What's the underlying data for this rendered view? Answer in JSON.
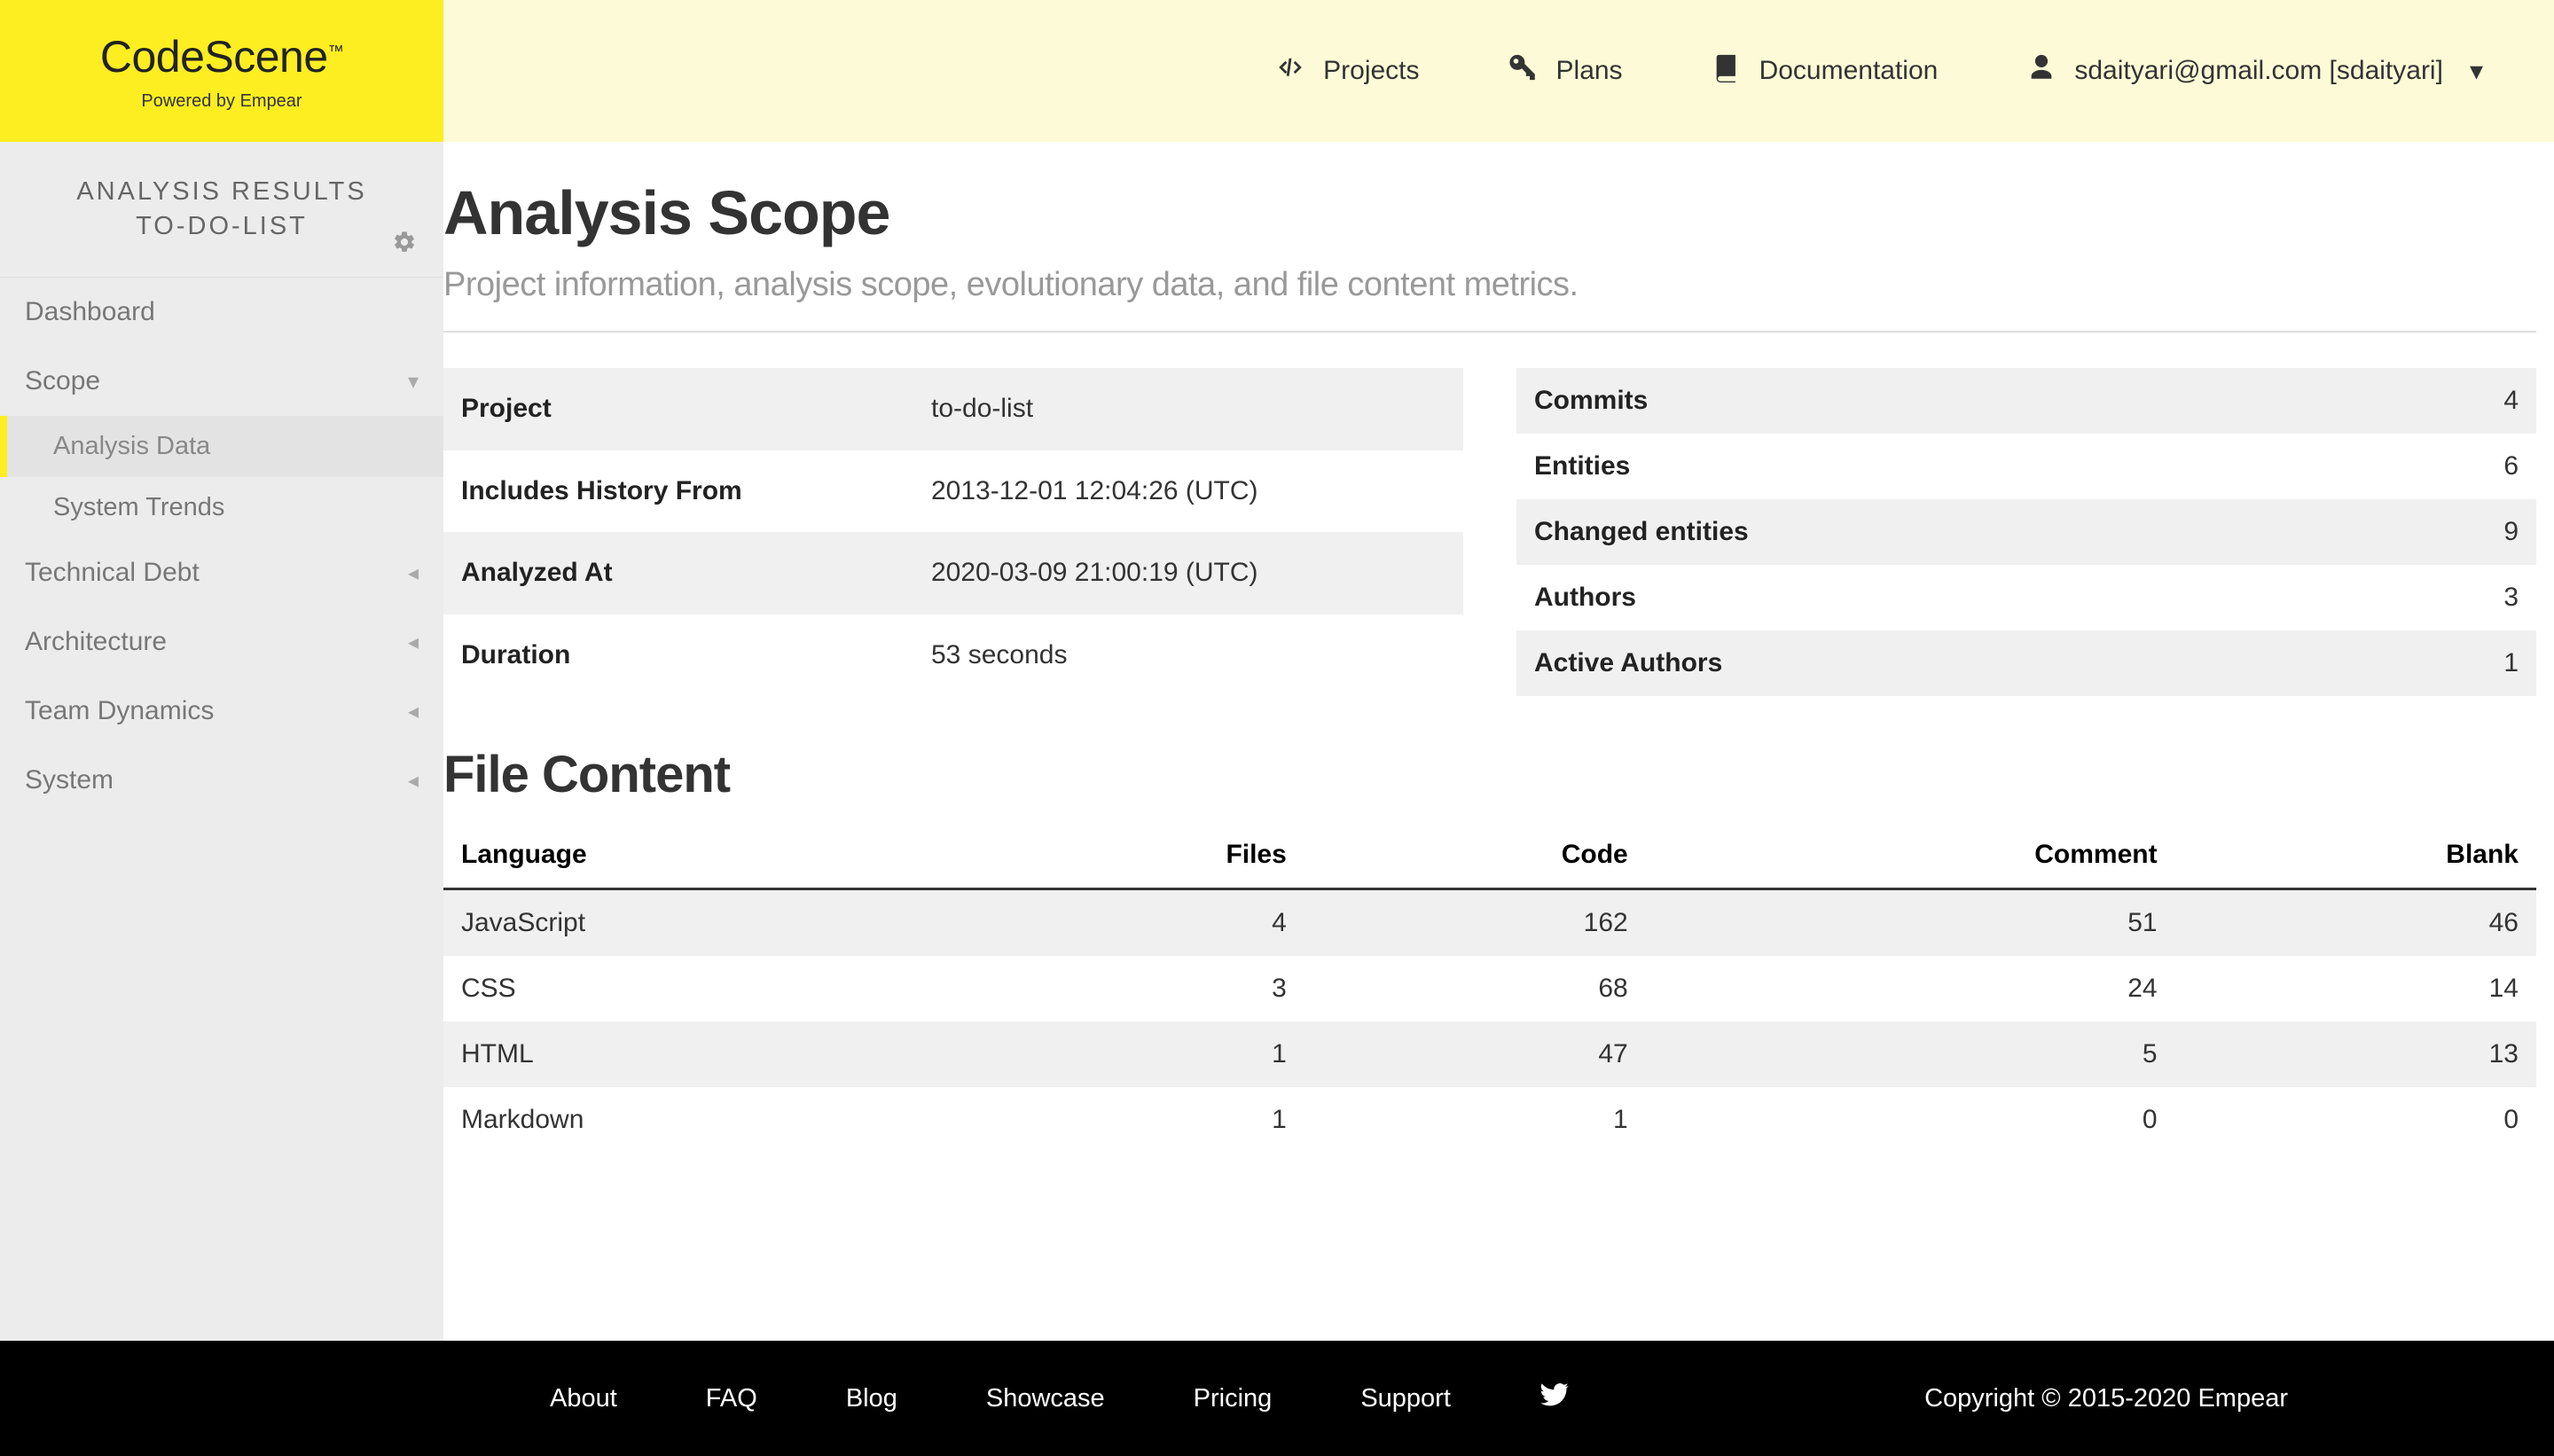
{
  "logo": {
    "title": "CodeScene",
    "tm": "™",
    "subtitle": "Powered by Empear"
  },
  "nav": {
    "projects": "Projects",
    "plans": "Plans",
    "documentation": "Documentation",
    "user": "sdaityari@gmail.com [sdaityari]"
  },
  "sidebar": {
    "title1": "ANALYSIS RESULTS",
    "title2": "TO-DO-LIST",
    "items": {
      "dashboard": "Dashboard",
      "scope": "Scope",
      "analysis_data": "Analysis Data",
      "system_trends": "System Trends",
      "technical_debt": "Technical Debt",
      "architecture": "Architecture",
      "team_dynamics": "Team Dynamics",
      "system": "System"
    }
  },
  "page": {
    "title": "Analysis Scope",
    "subtitle": "Project information, analysis scope, evolutionary data, and file content metrics."
  },
  "info_left": [
    {
      "label": "Project",
      "value": "to-do-list"
    },
    {
      "label": "Includes History From",
      "value": "2013-12-01 12:04:26 (UTC)"
    },
    {
      "label": "Analyzed At",
      "value": "2020-03-09 21:00:19 (UTC)"
    },
    {
      "label": "Duration",
      "value": "53 seconds"
    }
  ],
  "info_right": [
    {
      "label": "Commits",
      "value": "4"
    },
    {
      "label": "Entities",
      "value": "6"
    },
    {
      "label": "Changed entities",
      "value": "9"
    },
    {
      "label": "Authors",
      "value": "3"
    },
    {
      "label": "Active Authors",
      "value": "1"
    }
  ],
  "file_content": {
    "title": "File Content",
    "headers": {
      "language": "Language",
      "files": "Files",
      "code": "Code",
      "comment": "Comment",
      "blank": "Blank"
    },
    "rows": [
      {
        "language": "JavaScript",
        "files": "4",
        "code": "162",
        "comment": "51",
        "blank": "46"
      },
      {
        "language": "CSS",
        "files": "3",
        "code": "68",
        "comment": "24",
        "blank": "14"
      },
      {
        "language": "HTML",
        "files": "1",
        "code": "47",
        "comment": "5",
        "blank": "13"
      },
      {
        "language": "Markdown",
        "files": "1",
        "code": "1",
        "comment": "0",
        "blank": "0"
      }
    ]
  },
  "footer": {
    "about": "About",
    "faq": "FAQ",
    "blog": "Blog",
    "showcase": "Showcase",
    "pricing": "Pricing",
    "support": "Support",
    "copyright": "Copyright © 2015-2020 Empear"
  }
}
